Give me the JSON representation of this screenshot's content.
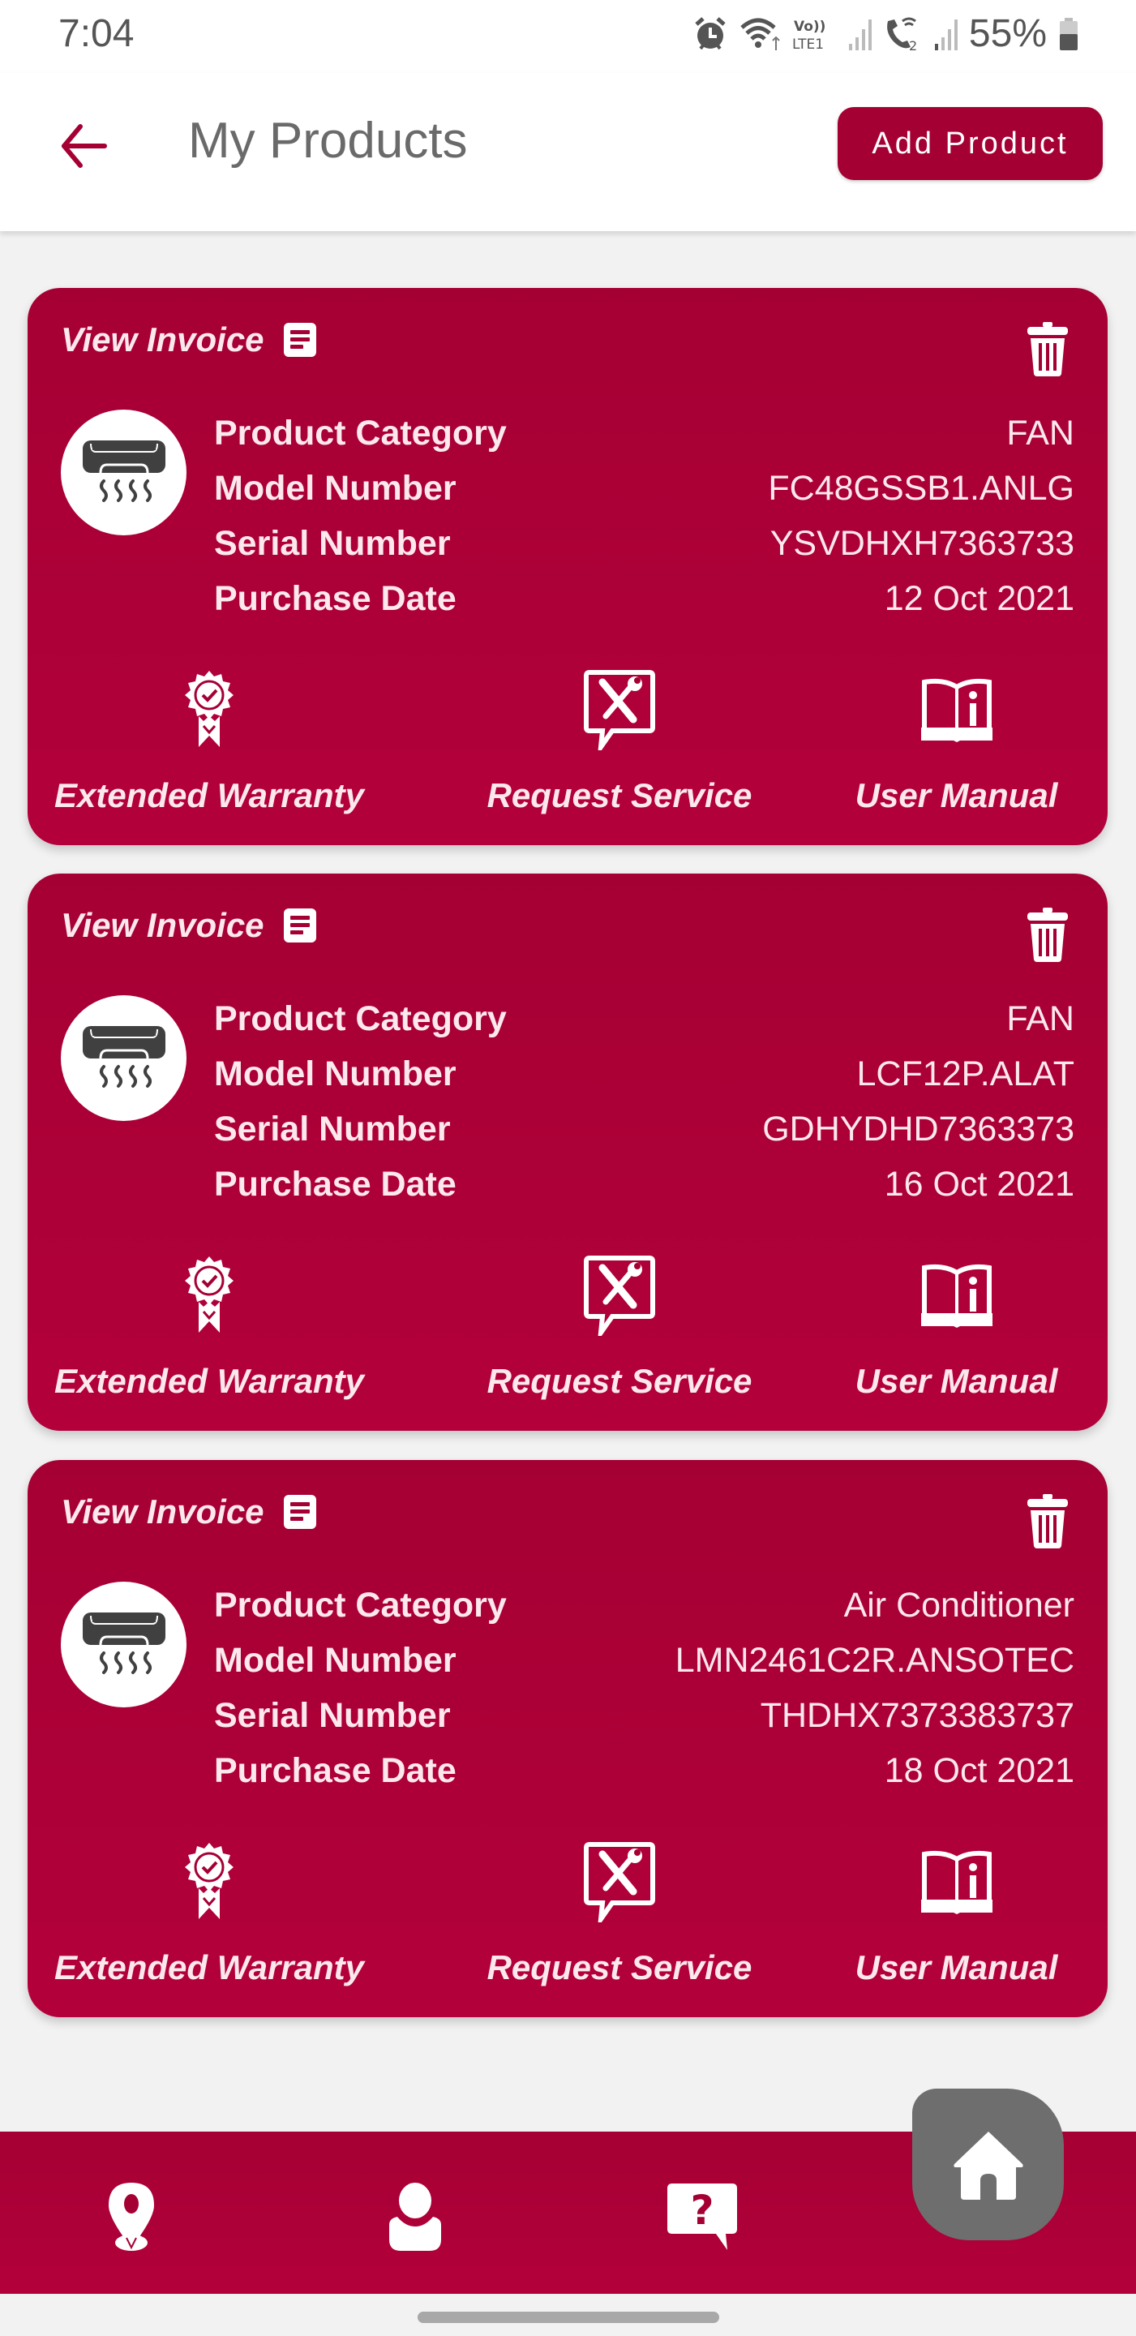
{
  "status_bar": {
    "time": "7:04",
    "battery_percent": "55%",
    "network_label": "Vo)) LTE1",
    "icons": [
      "alarm-icon",
      "wifi-icon",
      "volte-lte-icon",
      "signal-icon",
      "wifi-calling-icon",
      "signal-icon",
      "battery-icon"
    ]
  },
  "header": {
    "title": "My Products",
    "back_icon": "arrow-left-icon",
    "add_button_label": "Add Product"
  },
  "labels": {
    "view_invoice": "View Invoice",
    "product_category": "Product Category",
    "model_number": "Model Number",
    "serial_number": "Serial Number",
    "purchase_date": "Purchase Date",
    "extended_warranty": "Extended Warranty",
    "request_service": "Request Service",
    "user_manual": "User Manual"
  },
  "products": [
    {
      "category": "FAN",
      "model_number": "FC48GSSB1.ANLG",
      "serial_number": "YSVDHXH7363733",
      "purchase_date": "12 Oct 2021",
      "image_icon": "air-conditioner-icon"
    },
    {
      "category": "FAN",
      "model_number": "LCF12P.ALAT",
      "serial_number": "GDHYDHD7363373",
      "purchase_date": "16 Oct 2021",
      "image_icon": "air-conditioner-icon"
    },
    {
      "category": "Air Conditioner",
      "model_number": "LMN2461C2R.ANSOTEC",
      "serial_number": "THDHX7373383737",
      "purchase_date": "18 Oct 2021",
      "image_icon": "air-conditioner-icon"
    }
  ],
  "bottom_nav": {
    "items": [
      {
        "icon": "location-pin-icon"
      },
      {
        "icon": "user-icon"
      },
      {
        "icon": "help-chat-icon"
      },
      {
        "icon": "home-icon"
      }
    ]
  },
  "colors": {
    "brand": "#a50034",
    "fab": "#6e6e6e",
    "background": "#f2f2f2",
    "title_text": "#6a6a6a"
  }
}
